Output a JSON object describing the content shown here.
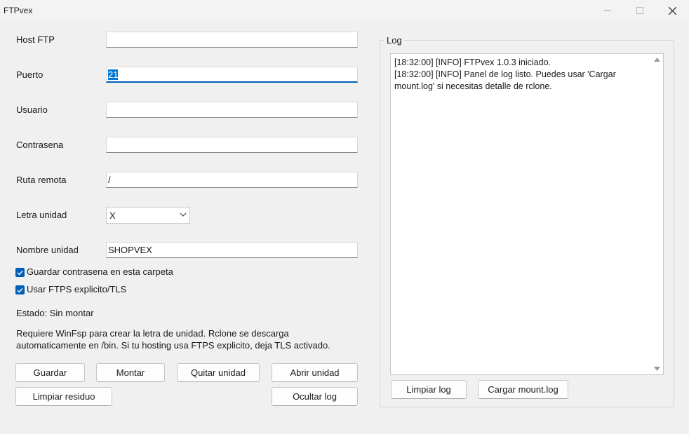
{
  "window": {
    "title": "FTPvex"
  },
  "form": {
    "host": {
      "label": "Host FTP",
      "value": ""
    },
    "port": {
      "label": "Puerto",
      "value": "21"
    },
    "user": {
      "label": "Usuario",
      "value": ""
    },
    "password": {
      "label": "Contrasena",
      "value": ""
    },
    "remote_path": {
      "label": "Ruta remota",
      "value": "/"
    },
    "drive_letter": {
      "label": "Letra unidad",
      "value": "X"
    },
    "drive_name": {
      "label": "Nombre unidad",
      "value": "SHOPVEX"
    },
    "save_password": {
      "label": "Guardar contrasena en esta carpeta",
      "checked": true
    },
    "use_ftps": {
      "label": "Usar FTPS explicito/TLS",
      "checked": true
    },
    "status": "Estado: Sin montar",
    "info_lines": [
      "Requiere WinFsp para crear la letra de unidad. Rclone se descarga",
      "automaticamente en /bin. Si tu hosting usa FTPS explicito, deja TLS activado."
    ]
  },
  "buttons": {
    "save": "Guardar",
    "mount": "Montar",
    "remove_drive": "Quitar unidad",
    "open_drive": "Abrir unidad",
    "clean_residue": "Limpiar residuo",
    "hide_log": "Ocultar log"
  },
  "log": {
    "title": "Log",
    "lines": [
      "[18:32:00] [INFO] FTPvex 1.0.3 iniciado.",
      "[18:32:00] [INFO] Panel de log listo. Puedes usar 'Cargar",
      "mount.log' si necesitas detalle de rclone."
    ],
    "clear_button": "Limpiar log",
    "load_button": "Cargar mount.log"
  },
  "colors": {
    "accent": "#005fb8",
    "selection": "#0078d7"
  }
}
